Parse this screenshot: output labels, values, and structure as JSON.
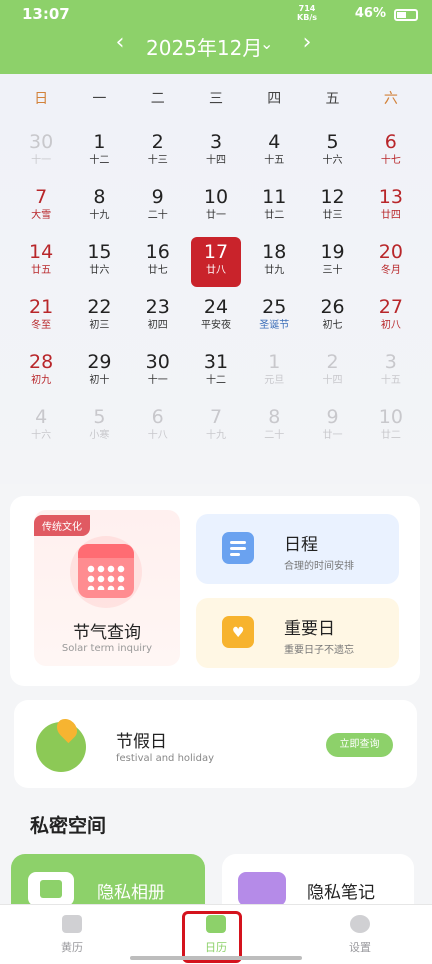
{
  "status_bar": {
    "time": "13:07",
    "speed_top": "714",
    "speed_unit": "KB/s",
    "battery": "46%"
  },
  "month_nav": {
    "prev_glyph": "‹",
    "title": "2025年12月",
    "dropdown_glyph": "⌄",
    "next_glyph": "›"
  },
  "calendar": {
    "weekdays": [
      "日",
      "一",
      "二",
      "三",
      "四",
      "五",
      "六"
    ],
    "weeks": [
      [
        {
          "d": "30",
          "l": "十一",
          "s": "faded"
        },
        {
          "d": "1",
          "l": "十二",
          "s": ""
        },
        {
          "d": "2",
          "l": "十三",
          "s": ""
        },
        {
          "d": "3",
          "l": "十四",
          "s": ""
        },
        {
          "d": "4",
          "l": "十五",
          "s": ""
        },
        {
          "d": "5",
          "l": "十六",
          "s": ""
        },
        {
          "d": "6",
          "l": "十七",
          "s": "red"
        }
      ],
      [
        {
          "d": "7",
          "l": "大雪",
          "s": "red"
        },
        {
          "d": "8",
          "l": "十九",
          "s": ""
        },
        {
          "d": "9",
          "l": "二十",
          "s": ""
        },
        {
          "d": "10",
          "l": "廿一",
          "s": ""
        },
        {
          "d": "11",
          "l": "廿二",
          "s": ""
        },
        {
          "d": "12",
          "l": "廿三",
          "s": ""
        },
        {
          "d": "13",
          "l": "廿四",
          "s": "red"
        }
      ],
      [
        {
          "d": "14",
          "l": "廿五",
          "s": "red"
        },
        {
          "d": "15",
          "l": "廿六",
          "s": ""
        },
        {
          "d": "16",
          "l": "廿七",
          "s": ""
        },
        {
          "d": "17",
          "l": "廿八",
          "s": "today"
        },
        {
          "d": "18",
          "l": "廿九",
          "s": ""
        },
        {
          "d": "19",
          "l": "三十",
          "s": ""
        },
        {
          "d": "20",
          "l": "冬月",
          "s": "red"
        }
      ],
      [
        {
          "d": "21",
          "l": "冬至",
          "s": "red"
        },
        {
          "d": "22",
          "l": "初三",
          "s": ""
        },
        {
          "d": "23",
          "l": "初四",
          "s": ""
        },
        {
          "d": "24",
          "l": "平安夜",
          "s": ""
        },
        {
          "d": "25",
          "l": "圣诞节",
          "s": "fest"
        },
        {
          "d": "26",
          "l": "初七",
          "s": ""
        },
        {
          "d": "27",
          "l": "初八",
          "s": "red"
        }
      ],
      [
        {
          "d": "28",
          "l": "初九",
          "s": "red"
        },
        {
          "d": "29",
          "l": "初十",
          "s": ""
        },
        {
          "d": "30",
          "l": "十一",
          "s": ""
        },
        {
          "d": "31",
          "l": "十二",
          "s": ""
        },
        {
          "d": "1",
          "l": "元旦",
          "s": "faded"
        },
        {
          "d": "2",
          "l": "十四",
          "s": "faded"
        },
        {
          "d": "3",
          "l": "十五",
          "s": "faded"
        }
      ],
      [
        {
          "d": "4",
          "l": "十六",
          "s": "faded"
        },
        {
          "d": "5",
          "l": "小寒",
          "s": "faded"
        },
        {
          "d": "6",
          "l": "十八",
          "s": "faded"
        },
        {
          "d": "7",
          "l": "十九",
          "s": "faded"
        },
        {
          "d": "8",
          "l": "二十",
          "s": "faded"
        },
        {
          "d": "9",
          "l": "廿一",
          "s": "faded"
        },
        {
          "d": "10",
          "l": "廿二",
          "s": "faded"
        }
      ]
    ]
  },
  "features": {
    "term": {
      "tag": "传统文化",
      "title": "节气查询",
      "subtitle": "Solar term inquiry"
    },
    "schedule": {
      "title": "日程",
      "subtitle": "合理的时间安排"
    },
    "important": {
      "title": "重要日",
      "subtitle": "重要日子不遗忘",
      "heart": "♥"
    }
  },
  "holiday": {
    "title": "节假日",
    "subtitle": "festival and holiday",
    "button": "立即查询"
  },
  "private_space": {
    "title": "私密空间",
    "album": "隐私相册",
    "notes": "隐私笔记"
  },
  "bottom_nav": {
    "items": [
      {
        "label": "黄历",
        "icon": "almanac-icon"
      },
      {
        "label": "日历",
        "icon": "calendar-icon"
      },
      {
        "label": "设置",
        "icon": "settings-icon"
      }
    ],
    "active_index": 1
  },
  "colors": {
    "accent": "#8dd16a",
    "today": "#c9232b",
    "weekend": "#b8262a",
    "highlight_outline": "#d4131d"
  }
}
